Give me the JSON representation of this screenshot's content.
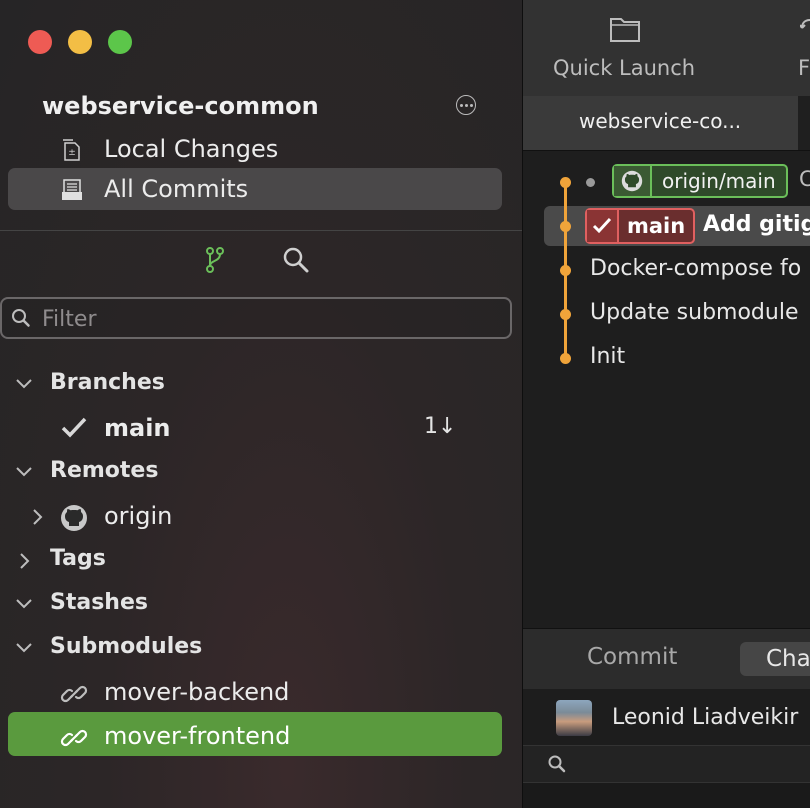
{
  "window": {
    "buttons": [
      "close",
      "minimize",
      "zoom"
    ]
  },
  "sidebar": {
    "repo_name": "webservice-common",
    "nav": [
      {
        "label": "Local Changes",
        "icon": "local-changes-icon"
      },
      {
        "label": "All Commits",
        "icon": "all-commits-icon"
      }
    ],
    "filter_placeholder": "Filter",
    "sections": {
      "branches": {
        "label": "Branches",
        "items": [
          {
            "label": "main",
            "count": "1↓"
          }
        ]
      },
      "remotes": {
        "label": "Remotes",
        "items": [
          {
            "label": "origin"
          }
        ]
      },
      "tags": {
        "label": "Tags"
      },
      "stashes": {
        "label": "Stashes"
      },
      "submodules": {
        "label": "Submodules",
        "items": [
          {
            "label": "mover-backend"
          },
          {
            "label": "mover-frontend"
          }
        ]
      }
    }
  },
  "toolbar": {
    "quick_launch": "Quick Launch",
    "second_button_partial": "F"
  },
  "tabs": [
    {
      "label": "webservice-co..."
    }
  ],
  "graph": {
    "commits": [
      {
        "refs": [
          {
            "name": "origin/main",
            "type": "remote"
          }
        ],
        "message_partial": "C"
      },
      {
        "refs": [
          {
            "name": "main",
            "type": "local"
          }
        ],
        "message_partial": "Add gitig"
      },
      {
        "message_partial": "Docker-compose fo"
      },
      {
        "message_partial": "Update submodule"
      },
      {
        "message_partial": "Init"
      }
    ]
  },
  "detail": {
    "tabs": [
      "Commit",
      "Cha"
    ],
    "author": "Leonid Liadveikir"
  },
  "colors": {
    "accent_green": "#5a9a3e",
    "graph_orange": "#f0a43a",
    "remote_badge": "#6bbf5a",
    "local_badge": "#e06060"
  }
}
